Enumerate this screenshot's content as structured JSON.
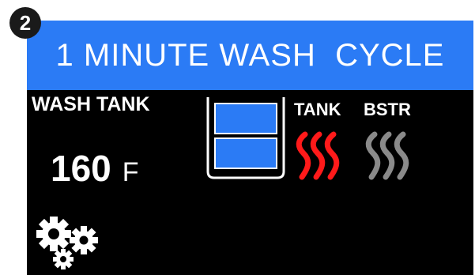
{
  "step": {
    "number": "2"
  },
  "header": {
    "title": "1 MINUTE WASH  CYCLE"
  },
  "wash_tank": {
    "label": "WASH TANK",
    "temperature": "160",
    "unit": "F"
  },
  "tank_level": {
    "filled_segments": 2,
    "total_segments": 2
  },
  "heaters": [
    {
      "label": "TANK",
      "state": "on",
      "color": "#ff1a1a"
    },
    {
      "label": "BSTR",
      "state": "off",
      "color": "#8a8a8a"
    }
  ],
  "icons": [
    "gears-icon"
  ],
  "colors": {
    "title_bar": "#2b7bf5",
    "background": "#000000",
    "water": "#2b7bf5",
    "heater_on": "#ff1a1a",
    "heater_off": "#8a8a8a"
  }
}
